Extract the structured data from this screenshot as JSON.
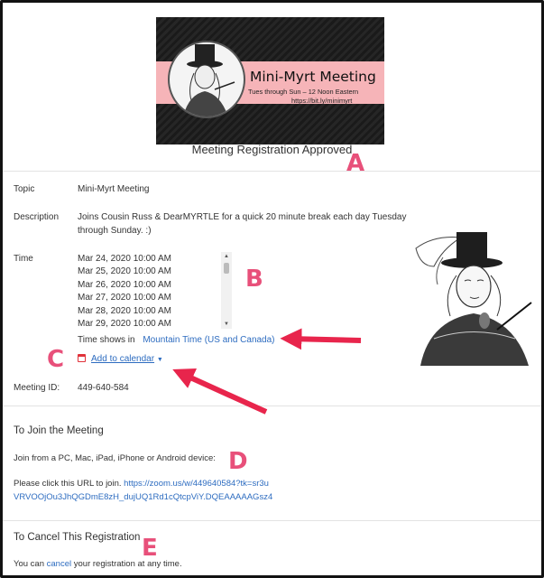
{
  "banner": {
    "title": "Mini-Myrt Meeting",
    "subtitle": "Tues through Sun – 12 Noon Eastern",
    "url": "https://bit.ly/minimyrt"
  },
  "status_heading": "Meeting Registration Approved",
  "annotations": {
    "a": "A",
    "b": "B",
    "c": "C",
    "d": "D",
    "e": "E",
    "arrow_color": "#e8254c"
  },
  "topic": {
    "label": "Topic",
    "value": "Mini-Myrt Meeting"
  },
  "description": {
    "label": "Description",
    "line1": "Joins Cousin Russ & DearMYRTLE for a quick 20 minute break each day Tuesday",
    "line2": "through Sunday. :)"
  },
  "time": {
    "label": "Time",
    "items": [
      "Mar 24, 2020 10:00 AM",
      "Mar 25, 2020 10:00 AM",
      "Mar 26, 2020 10:00 AM",
      "Mar 27, 2020 10:00 AM",
      "Mar 28, 2020 10:00 AM",
      "Mar 29, 2020 10:00 AM"
    ],
    "shows_in_label": "Time shows in",
    "timezone": "Mountain Time (US and Canada)",
    "add_to_calendar": "Add to calendar"
  },
  "meeting_id": {
    "label": "Meeting ID:",
    "value": "449-640-584"
  },
  "join": {
    "heading": "To Join the Meeting",
    "devices": "Join from a PC, Mac, iPad, iPhone or Android device:",
    "click_text": "Please click this URL to join.",
    "url_line1": "https://zoom.us/w/449640584?tk=sr3u",
    "url_line2": "VRVOOjOu3JhQGDmE8zH_dujUQ1Rd1cQtcpViY.DQEAAAAAGsz4"
  },
  "cancel": {
    "heading": "To Cancel This Registration",
    "text_before": "You can",
    "link": "cancel",
    "text_after": "your registration at any time."
  },
  "colors": {
    "link": "#2d6cc0",
    "banner_pink": "#f6b4b8",
    "annotation": "#e8507a"
  }
}
